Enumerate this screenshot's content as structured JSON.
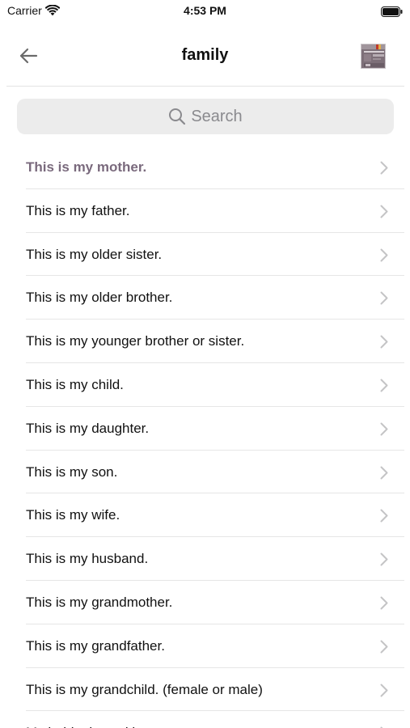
{
  "status_bar": {
    "carrier": "Carrier",
    "time": "4:53 PM"
  },
  "nav": {
    "title": "family",
    "back_icon": "arrow-left-icon"
  },
  "search": {
    "placeholder": "Search"
  },
  "colors": {
    "active_row_text": "#7a6a7d",
    "chevron": "#c4c4c6",
    "search_bg": "#ececec"
  },
  "list": {
    "items": [
      {
        "label": "This is my mother."
      },
      {
        "label": "This is my father."
      },
      {
        "label": "This is my older sister."
      },
      {
        "label": "This is my older brother."
      },
      {
        "label": "This is my younger brother or sister."
      },
      {
        "label": "This is my child."
      },
      {
        "label": "This is my daughter."
      },
      {
        "label": "This is my son."
      },
      {
        "label": "This is my wife."
      },
      {
        "label": "This is my husband."
      },
      {
        "label": "This is my grandmother."
      },
      {
        "label": "This is my grandfather."
      },
      {
        "label": "This is my grandchild. (female or male)"
      },
      {
        "label": "My hobby is cooking."
      }
    ]
  }
}
